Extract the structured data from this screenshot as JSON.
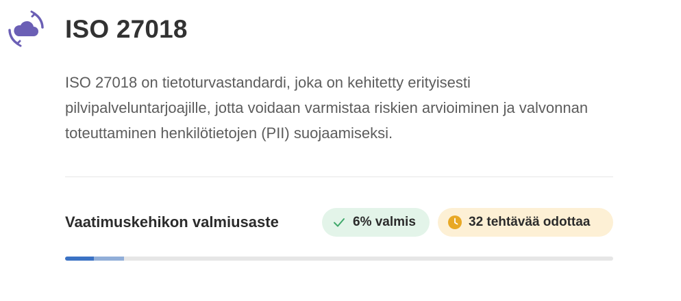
{
  "header": {
    "logo_icon": "cloud-sync-icon",
    "title": "ISO 27018"
  },
  "description": "ISO 27018 on tietoturvastandardi, joka on kehitetty erityisesti pilvipalveluntarjoajille, jotta voidaan varmistaa riskien arvioiminen ja valvonnan toteuttaminen henkilötietojen (PII) suojaamiseksi.",
  "readiness": {
    "label": "Vaatimuskehikon valmiusaste",
    "done_badge": {
      "icon": "check-icon",
      "text": "6% valmis",
      "color": "#e3f4e9"
    },
    "pending_badge": {
      "icon": "clock-icon",
      "text": "32 tehtävää odottaa",
      "color": "#fdf0d5"
    },
    "progress": {
      "complete_fraction": 0.053,
      "in_progress_fraction": 0.055,
      "complete_color": "#3b72c4",
      "in_progress_color": "#91aed8",
      "track_color": "#e6e6e6"
    }
  },
  "colors": {
    "logo_accent": "#6b5fb5",
    "check": "#3fa86a",
    "clock": "#e8a825"
  }
}
